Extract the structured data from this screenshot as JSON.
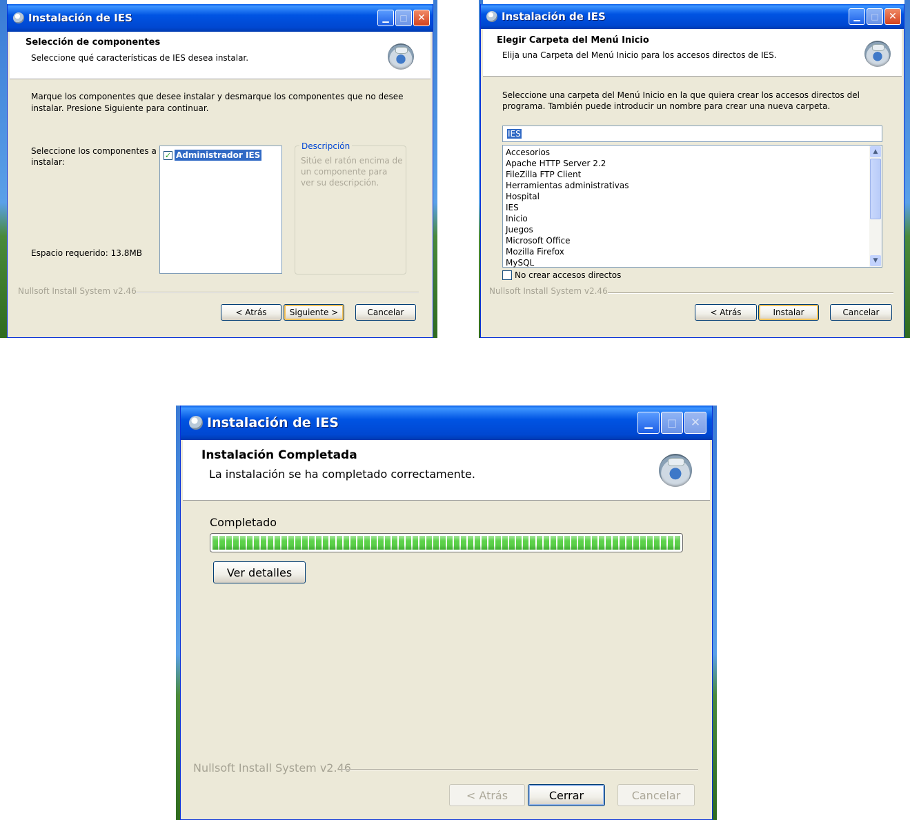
{
  "w1": {
    "title": "Instalación de IES",
    "header_title": "Selección de componentes",
    "header_subtitle": "Seleccione qué características de IES desea instalar.",
    "intro_line1": "Marque los componentes que desee instalar y desmarque los componentes que no desee",
    "intro_line2": "instalar. Presione Siguiente para continuar.",
    "select_label_line1": "Seleccione los componentes a",
    "select_label_line2": "instalar:",
    "component": "Administrador IES",
    "description_title": "Descripción",
    "description_line1": "Sitúe el ratón encima de",
    "description_line2": "un componente para",
    "description_line3": "ver su descripción.",
    "space_required": "Espacio requerido: 13.8MB",
    "nsis": "Nullsoft Install System v2.46",
    "back": "< Atrás",
    "next": "Siguiente >",
    "cancel": "Cancelar"
  },
  "w2": {
    "title": "Instalación de IES",
    "header_title": "Elegir Carpeta del Menú Inicio",
    "header_subtitle": "Elija una Carpeta del Menú Inicio para los accesos directos de IES.",
    "intro_line1": "Seleccione una carpeta del Menú Inicio en la que quiera crear los accesos directos del",
    "intro_line2": "programa. También puede introducir un nombre para crear una nueva carpeta.",
    "folder_value": "IES",
    "folders": [
      "Accesorios",
      "Apache HTTP Server 2.2",
      "FileZilla FTP Client",
      "Herramientas administrativas",
      "Hospital",
      "IES",
      "Inicio",
      "Juegos",
      "Microsoft Office",
      "Mozilla Firefox",
      "MySQL"
    ],
    "no_shortcuts": "No crear accesos directos",
    "nsis": "Nullsoft Install System v2.46",
    "back": "< Atrás",
    "install": "Instalar",
    "cancel": "Cancelar"
  },
  "w3": {
    "title": "Instalación de IES",
    "header_title": "Instalación Completada",
    "header_subtitle": "La instalación se ha completado correctamente.",
    "status": "Completado",
    "progress": 1.0,
    "details": "Ver detalles",
    "nsis": "Nullsoft Install System v2.46",
    "back": "< Atrás",
    "close": "Cerrar",
    "cancel": "Cancelar"
  },
  "colors": {
    "titlebar": "#0054e3",
    "dialog_bg": "#ece9d8",
    "progress_green": "#5cd14a",
    "selection": "#316ac5"
  }
}
